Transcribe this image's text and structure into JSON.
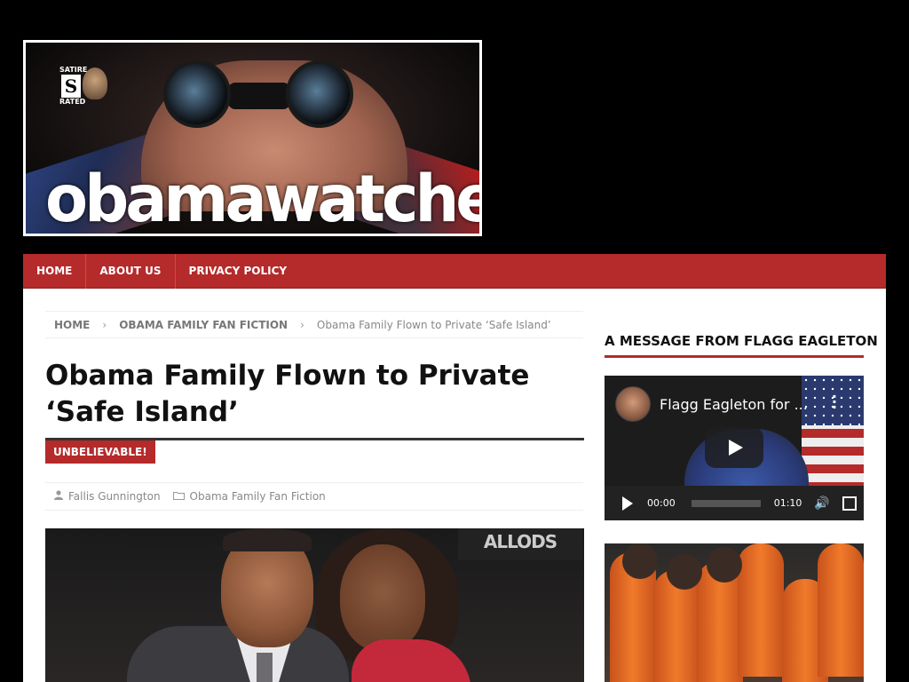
{
  "site": {
    "logo_text": "obamawatcher",
    "badge_top": "SATIRE",
    "badge_letter": "S",
    "badge_bottom": "RATED"
  },
  "nav": {
    "items": [
      {
        "label": "HOME"
      },
      {
        "label": "ABOUT US"
      },
      {
        "label": "PRIVACY POLICY"
      }
    ]
  },
  "breadcrumb": {
    "home": "HOME",
    "category": "OBAMA FAMILY FAN FICTION",
    "current": "Obama Family Flown to Private ‘Safe Island’",
    "separator": "›"
  },
  "article": {
    "title": "Obama Family Flown to Private ‘Safe Island’",
    "tag": "UNBELIEVABLE!",
    "author": "Fallis Gunnington",
    "category": "Obama Family Fan Fiction",
    "image_watermark": "ALLODS"
  },
  "sidebar": {
    "widget_title": "A MESSAGE FROM FLAGG EAGLETON",
    "video": {
      "title": "Flagg Eagleton for ...",
      "current_time": "00:00",
      "duration": "01:10"
    }
  },
  "colors": {
    "accent": "#b52a2a",
    "background": "#000000",
    "content": "#ffffff"
  },
  "icons": {
    "author": "user-icon",
    "category": "folder-icon"
  }
}
